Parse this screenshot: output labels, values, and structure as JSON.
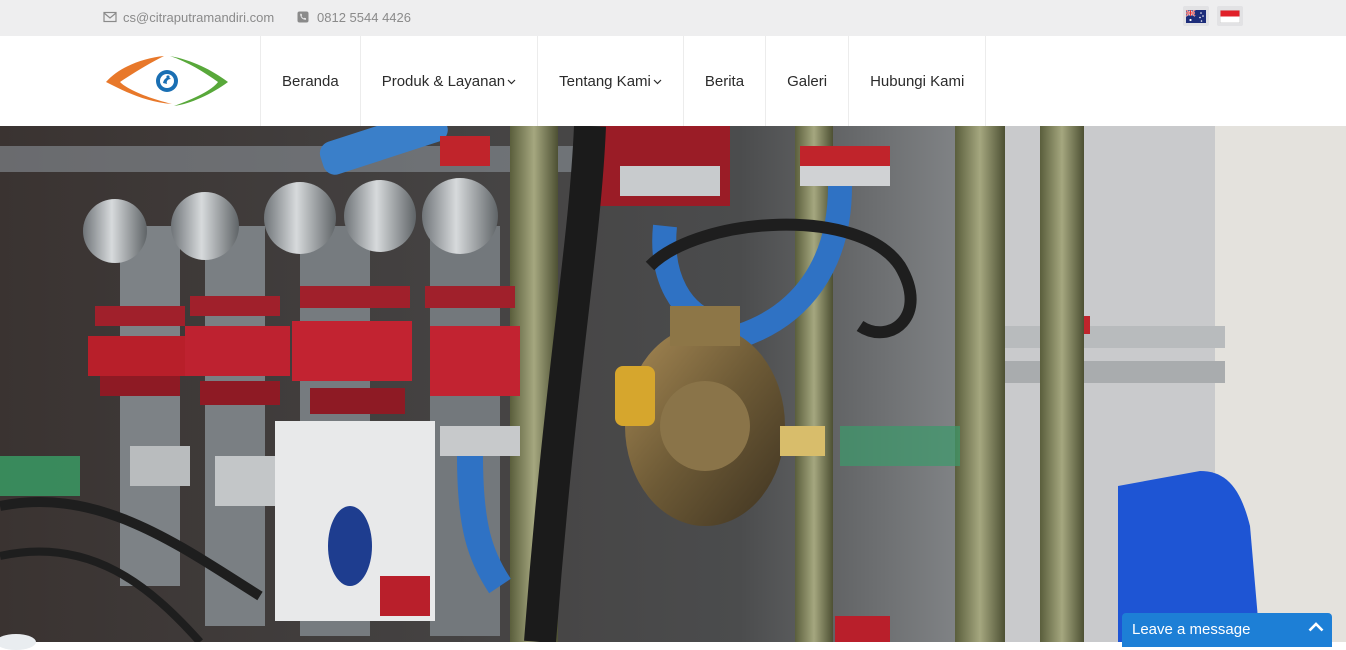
{
  "topbar": {
    "email": "cs@citraputramandiri.com",
    "email_icon": "envelope-icon",
    "phone": "0812 5544 4426",
    "phone_icon": "phone-icon",
    "languages": [
      {
        "name": "flag-australia-icon"
      },
      {
        "name": "flag-indonesia-icon"
      }
    ]
  },
  "header": {
    "logo_icon": "citra-putra-mandiri-logo",
    "nav": [
      {
        "label": "Beranda",
        "dropdown": false
      },
      {
        "label": "Produk & Layanan",
        "dropdown": true
      },
      {
        "label": "Tentang Kami",
        "dropdown": true
      },
      {
        "label": "Berita",
        "dropdown": false
      },
      {
        "label": "Galeri",
        "dropdown": false
      },
      {
        "label": "Hubungi Kami",
        "dropdown": false
      }
    ]
  },
  "hero": {
    "image": "industrial-valves-and-pipes-photo"
  },
  "chat": {
    "label": "Leave a message",
    "icon": "chevron-up-icon"
  },
  "colors": {
    "topbar_bg": "#eeeeef",
    "accent_orange": "#e8782a",
    "accent_green": "#58a83a",
    "accent_blue": "#1a6fb3",
    "chat_bg": "#1d7fd6"
  }
}
